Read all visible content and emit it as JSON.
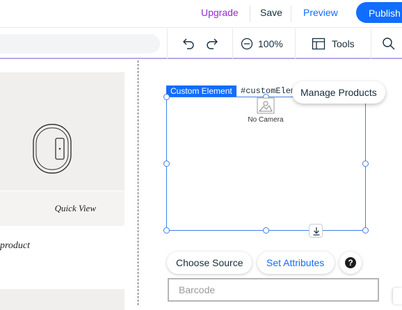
{
  "header": {
    "upgrade_label": "Upgrade",
    "save_label": "Save",
    "preview_label": "Preview",
    "publish_label": "Publish"
  },
  "toolbar": {
    "zoom_value": "100%",
    "tools_label": "Tools"
  },
  "canvas": {
    "quick_view_label": "Quick View",
    "product_text": "product"
  },
  "selection": {
    "element_type_label": "Custom Element",
    "element_id": "#customElement1",
    "manage_products_label": "Manage Products",
    "camera_status": "No Camera"
  },
  "controls": {
    "choose_source_label": "Choose Source",
    "set_attributes_label": "Set Attributes",
    "help_glyph": "?",
    "barcode_placeholder": "Barcode"
  },
  "colors": {
    "accent": "#116dff",
    "upgrade": "#9a27d5",
    "selection": "#3f7ee6"
  }
}
